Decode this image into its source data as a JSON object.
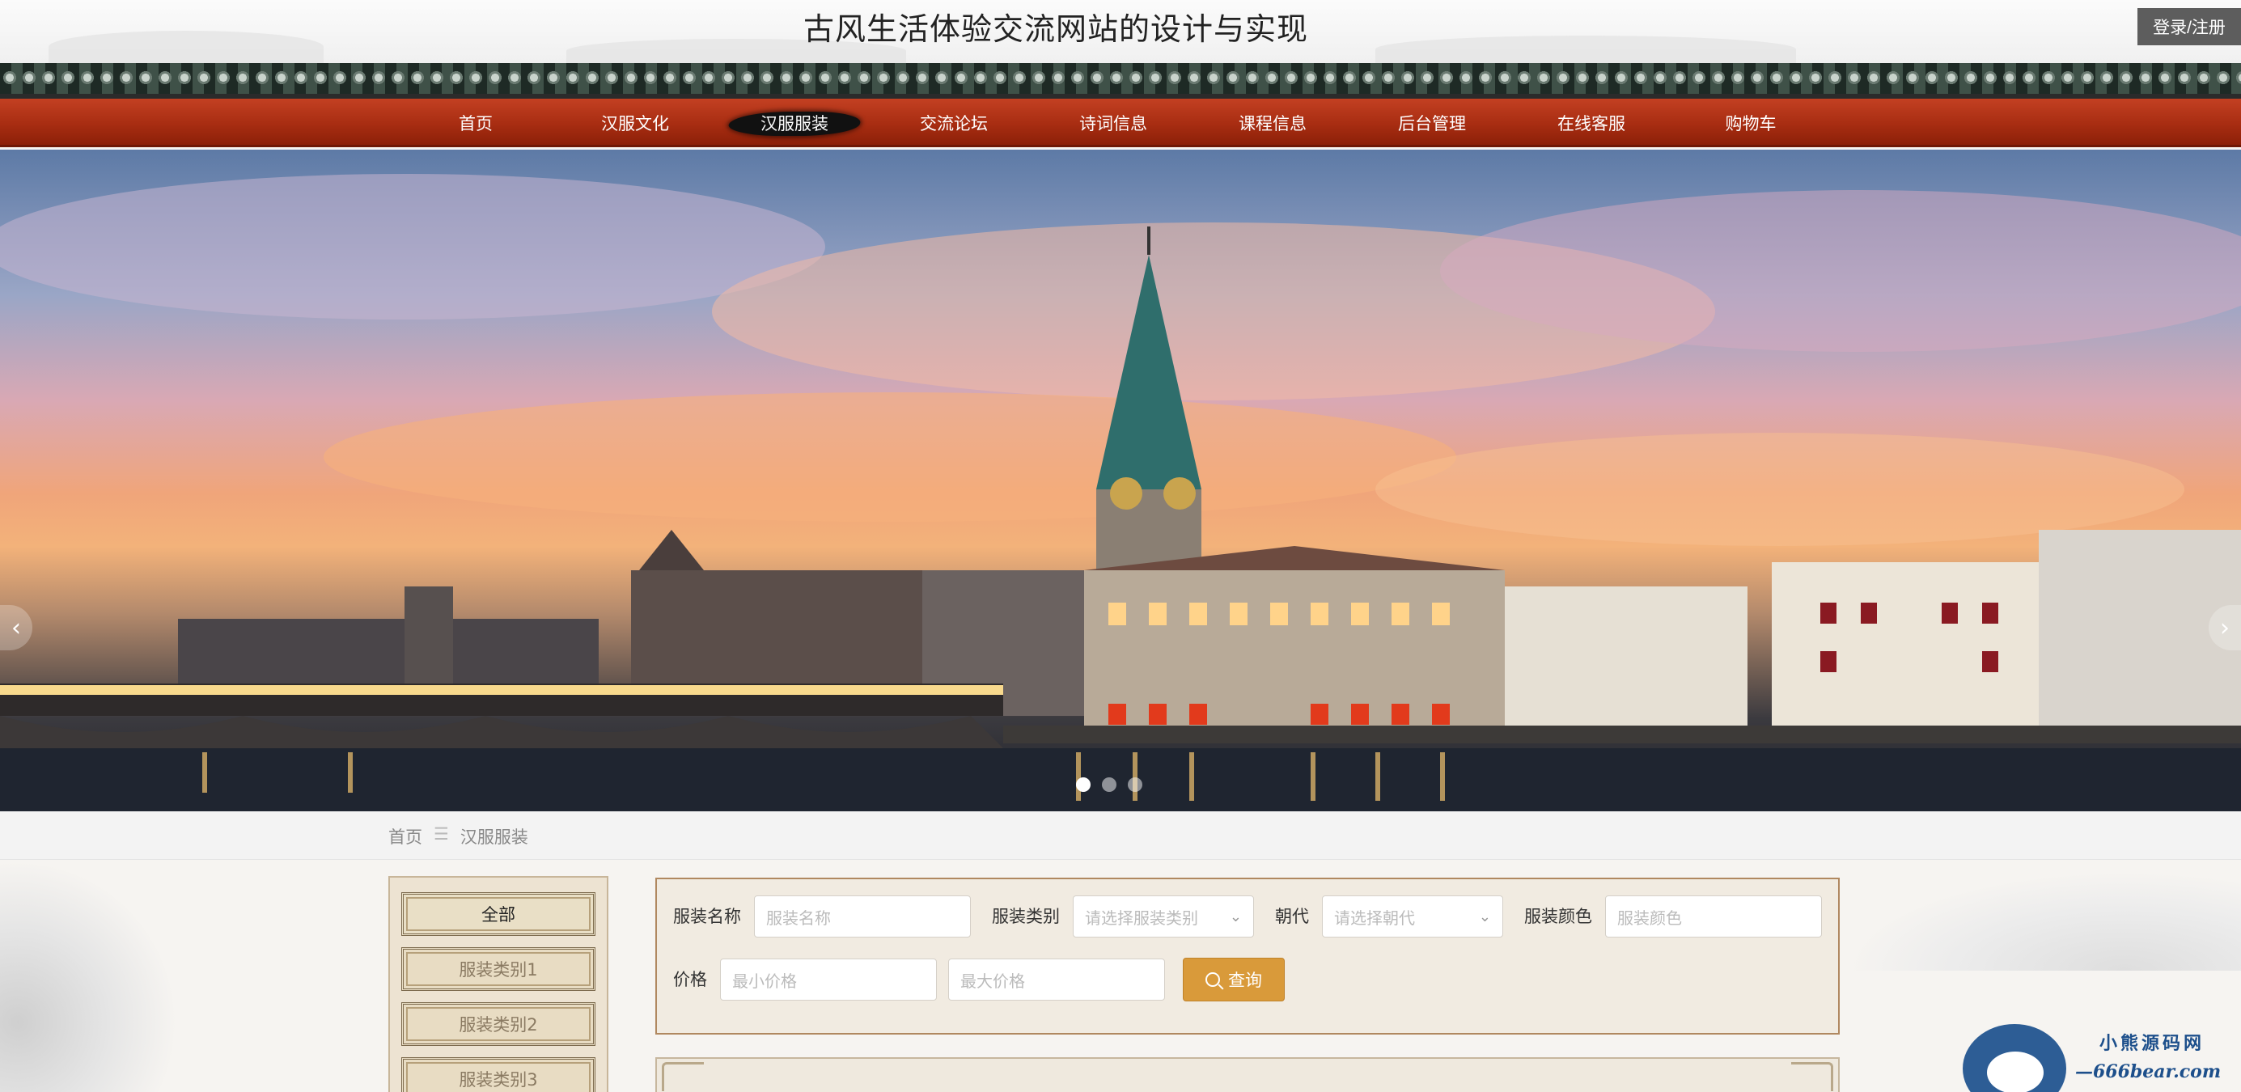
{
  "header": {
    "site_title": "古风生活体验交流网站的设计与实现",
    "login_label": "登录/注册"
  },
  "nav": {
    "items": [
      {
        "label": "首页"
      },
      {
        "label": "汉服文化"
      },
      {
        "label": "汉服服装",
        "active": true
      },
      {
        "label": "交流论坛"
      },
      {
        "label": "诗词信息"
      },
      {
        "label": "课程信息"
      },
      {
        "label": "后台管理"
      },
      {
        "label": "在线客服"
      },
      {
        "label": "购物车"
      }
    ]
  },
  "banner": {
    "prev_glyph": "‹",
    "next_glyph": "›",
    "slide_count": 3,
    "active_slide": 1
  },
  "breadcrumb": {
    "home": "首页",
    "separator": "☰",
    "current": "汉服服装"
  },
  "sidebar": {
    "categories": [
      {
        "label": "全部",
        "active": true
      },
      {
        "label": "服装类别1"
      },
      {
        "label": "服装类别2"
      },
      {
        "label": "服装类别3"
      }
    ]
  },
  "search": {
    "name_label": "服装名称",
    "name_placeholder": "服装名称",
    "category_label": "服装类别",
    "category_placeholder": "请选择服装类别",
    "dynasty_label": "朝代",
    "dynasty_placeholder": "请选择朝代",
    "color_label": "服装颜色",
    "color_placeholder": "服装颜色",
    "price_label": "价格",
    "min_price_placeholder": "最小价格",
    "max_price_placeholder": "最大价格",
    "query_label": "查询"
  },
  "watermark": {
    "cn": "小熊源码网",
    "en": "—666bear.com—"
  },
  "colors": {
    "nav_red": "#a82d12",
    "query_orange": "#d99a3a",
    "panel_border": "#b08860"
  }
}
